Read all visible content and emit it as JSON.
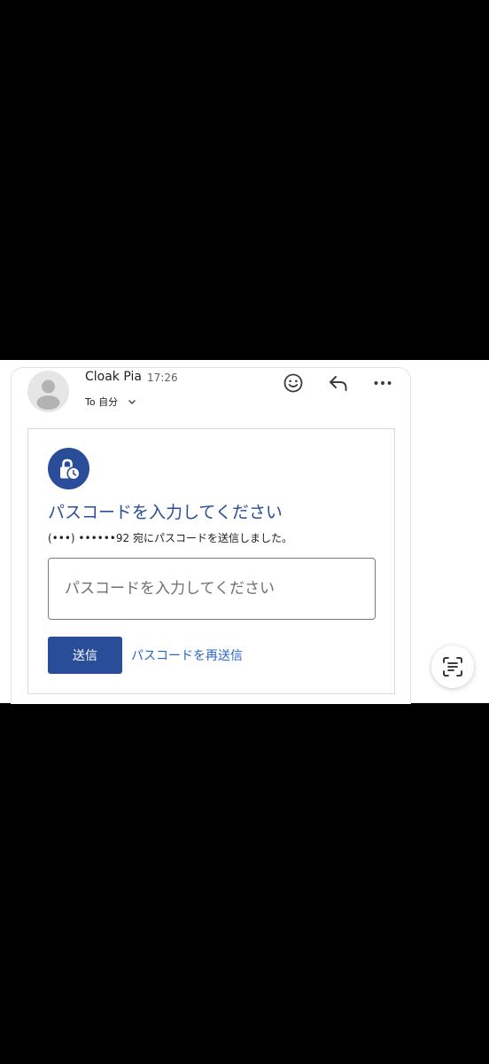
{
  "email": {
    "sender_name": "Cloak Pia",
    "time": "17:26",
    "recipient_label": "To 自分",
    "icons": {
      "avatar": "person-silhouette-icon",
      "emoji": "smiley-icon",
      "reply": "reply-arrow-icon",
      "more": "more-horizontal-icon",
      "expand": "chevron-down-icon"
    }
  },
  "passcode_card": {
    "badge_icon": "lock-clock-icon",
    "heading": "パスコードを入力してください",
    "sent_note": "(•••) ••••••92 宛にパスコードを送信しました。",
    "input_placeholder": "パスコードを入力してください",
    "input_value": "",
    "submit_label": "送信",
    "resend_label": "パスコードを再送信"
  },
  "overlay": {
    "scan_icon": "text-scan-icon"
  },
  "colors": {
    "accent": "#2a4d9a",
    "link": "#2a66c8",
    "background": "#000000",
    "card": "#ffffff"
  }
}
